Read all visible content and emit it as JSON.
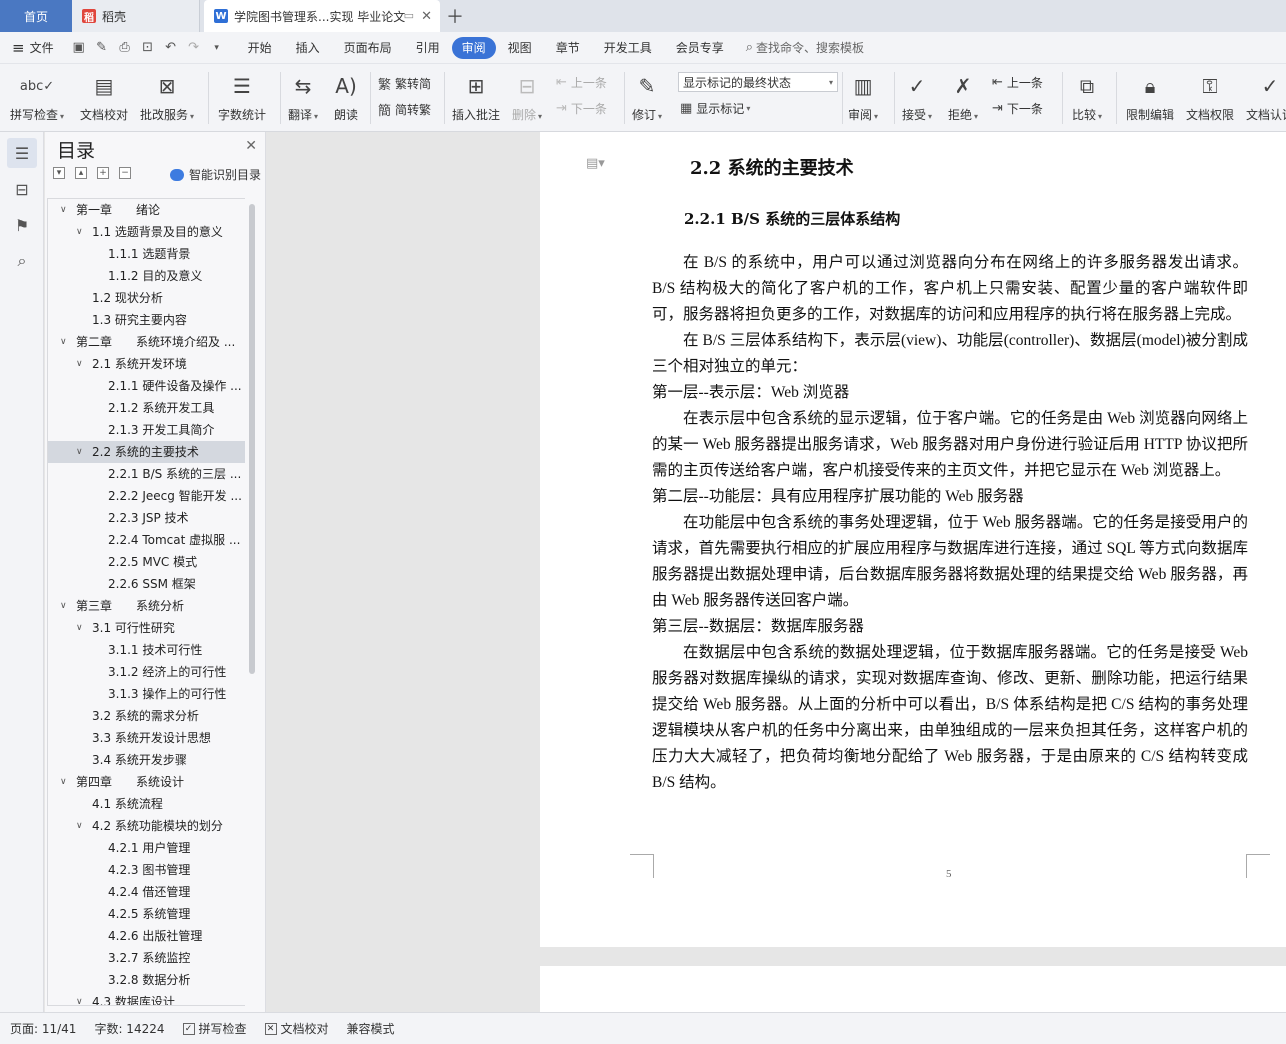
{
  "tabs": {
    "home": "首页",
    "draft": "稻壳",
    "doc": "学院图书管理系...实现 毕业论文"
  },
  "menu": {
    "file": "文件",
    "tabs": [
      "开始",
      "插入",
      "页面布局",
      "引用",
      "审阅",
      "视图",
      "章节",
      "开发工具",
      "会员专享"
    ],
    "active_tab": "审阅",
    "search": "查找命令、搜索模板"
  },
  "ribbon": {
    "spell_check": "拼写检查",
    "doc_proof": "文档校对",
    "batch_service": "批改服务",
    "word_count": "字数统计",
    "translate": "翻译",
    "read_aloud": "朗读",
    "trad_to_simp": "繁转简",
    "simp_to_trad": "简转繁",
    "insert_comment": "插入批注",
    "delete": "删除",
    "prev_comment": "上一条",
    "next_comment": "下一条",
    "revise": "修订",
    "markup_mode": "显示标记的最终状态",
    "show_markup": "显示标记",
    "review": "审阅",
    "accept": "接受",
    "reject": "拒绝",
    "prev": "上一条",
    "next": "下一条",
    "compare": "比较",
    "restrict_edit": "限制编辑",
    "doc_permission": "文档权限",
    "doc_cert": "文档认证"
  },
  "toc": {
    "title": "目录",
    "smart": "智能识别目录",
    "items": [
      {
        "label": "第一章　　绪论",
        "level": 0,
        "arrow": true
      },
      {
        "label": "1.1  选题背景及目的意义",
        "level": 1,
        "arrow": true
      },
      {
        "label": "1.1.1  选题背景",
        "level": 2
      },
      {
        "label": "1.1.2  目的及意义",
        "level": 2
      },
      {
        "label": "1.2  现状分析",
        "level": 1
      },
      {
        "label": "1.3  研究主要内容",
        "level": 1
      },
      {
        "label": "第二章　　系统环境介绍及 ...",
        "level": 0,
        "arrow": true
      },
      {
        "label": "2.1  系统开发环境",
        "level": 1,
        "arrow": true
      },
      {
        "label": "2.1.1  硬件设备及操作 ...",
        "level": 2
      },
      {
        "label": "2.1.2  系统开发工具",
        "level": 2
      },
      {
        "label": "2.1.3  开发工具简介",
        "level": 2
      },
      {
        "label": "2.2  系统的主要技术",
        "level": 1,
        "arrow": true,
        "selected": true
      },
      {
        "label": "2.2.1 B/S 系统的三层 ...",
        "level": 2
      },
      {
        "label": "2.2.2 Jeecg 智能开发 ...",
        "level": 2
      },
      {
        "label": "2.2.3 JSP 技术",
        "level": 2
      },
      {
        "label": "2.2.4 Tomcat 虚拟服 ...",
        "level": 2
      },
      {
        "label": "2.2.5 MVC 模式",
        "level": 2
      },
      {
        "label": "2.2.6 SSM 框架",
        "level": 2
      },
      {
        "label": "第三章　　系统分析",
        "level": 0,
        "arrow": true
      },
      {
        "label": "3.1  可行性研究",
        "level": 1,
        "arrow": true
      },
      {
        "label": "3.1.1  技术可行性",
        "level": 2
      },
      {
        "label": "3.1.2  经济上的可行性",
        "level": 2
      },
      {
        "label": "3.1.3  操作上的可行性",
        "level": 2
      },
      {
        "label": "3.2  系统的需求分析",
        "level": 1
      },
      {
        "label": "3.3  系统开发设计思想",
        "level": 1
      },
      {
        "label": "3.4  系统开发步骤",
        "level": 1
      },
      {
        "label": "第四章　　系统设计",
        "level": 0,
        "arrow": true
      },
      {
        "label": "4.1 系统流程",
        "level": 1
      },
      {
        "label": "4.2  系统功能模块的划分",
        "level": 1,
        "arrow": true
      },
      {
        "label": "4.2.1 用户管理",
        "level": 2
      },
      {
        "label": "4.2.3  图书管理",
        "level": 2
      },
      {
        "label": "4.2.4  借还管理",
        "level": 2
      },
      {
        "label": "4.2.5  系统管理",
        "level": 2
      },
      {
        "label": "4.2.6  出版社管理",
        "level": 2
      },
      {
        "label": "3.2.7  系统监控",
        "level": 2
      },
      {
        "label": "3.2.8  数据分析",
        "level": 2
      },
      {
        "label": "4.3 数据库设计",
        "level": 1,
        "arrow": true
      }
    ]
  },
  "document": {
    "heading2": "2.2  系统的主要技术",
    "heading3": "2.2.1 B/S 系统的三层体系结构",
    "paragraphs": [
      {
        "text": "在 B/S 的系统中，用户可以通过浏览器向分布在网络上的许多服务器发出请求。B/S 结构极大的简化了客户机的工作，客户机上只需安装、配置少量的客户端软件即可，服务器将担负更多的工作，对数据库的访问和应用程序的执行将在服务器上完成。",
        "indent": true
      },
      {
        "text": "在 B/S 三层体系结构下，表示层(view)、功能层(controller)、数据层(model)被分割成三个相对独立的单元：",
        "indent": true
      },
      {
        "text": "第一层--表示层：Web 浏览器",
        "indent": false
      },
      {
        "text": "在表示层中包含系统的显示逻辑，位于客户端。它的任务是由 Web 浏览器向网络上的某一 Web 服务器提出服务请求，Web 服务器对用户身份进行验证后用 HTTP 协议把所需的主页传送给客户端，客户机接受传来的主页文件，并把它显示在 Web 浏览器上。",
        "indent": true
      },
      {
        "text": "第二层--功能层：具有应用程序扩展功能的 Web 服务器",
        "indent": false
      },
      {
        "text": "在功能层中包含系统的事务处理逻辑，位于 Web 服务器端。它的任务是接受用户的请求，首先需要执行相应的扩展应用程序与数据库进行连接，通过 SQL 等方式向数据库服务器提出数据处理申请，后台数据库服务器将数据处理的结果提交给 Web 服务器，再由 Web 服务器传送回客户端。",
        "indent": true
      },
      {
        "text": "第三层--数据层：数据库服务器",
        "indent": false
      },
      {
        "text": "在数据层中包含系统的数据处理逻辑，位于数据库服务器端。它的任务是接受 Web 服务器对数据库操纵的请求，实现对数据库查询、修改、更新、删除功能，把运行结果提交给 Web 服务器。从上面的分析中可以看出，B/S 体系结构是把 C/S 结构的事务处理逻辑模块从客户机的任务中分离出来，由单独组成的一层来负担其任务，这样客户机的压力大大减轻了，把负荷均衡地分配给了 Web 服务器，于是由原来的 C/S 结构转变成 B/S 结构。",
        "indent": true
      }
    ],
    "page_number": "5"
  },
  "status": {
    "page": "页面: 11/41",
    "words": "字数: 14224",
    "spell": "拼写检查",
    "proof": "文档校对",
    "compat": "兼容模式"
  }
}
